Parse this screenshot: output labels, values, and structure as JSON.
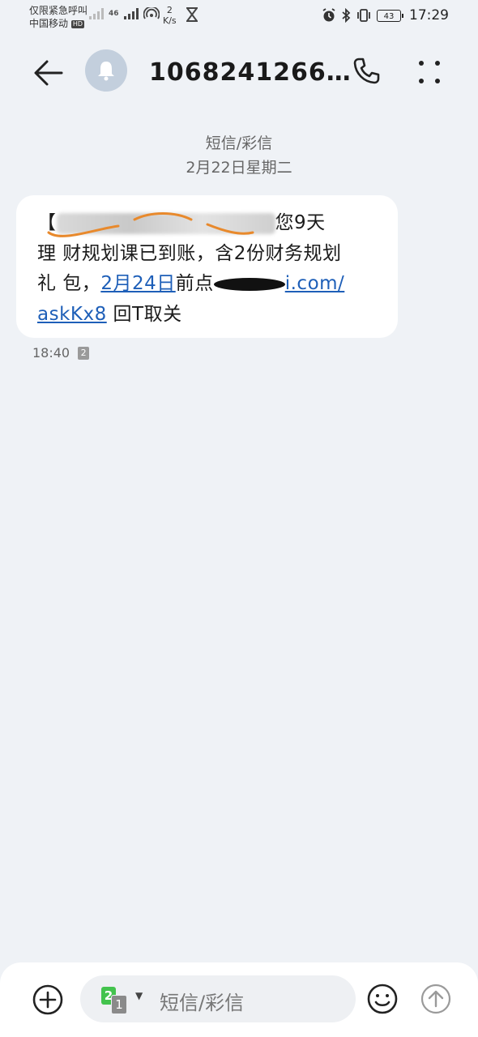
{
  "status_bar": {
    "emergency_text": "仅限紧急呼叫",
    "carrier": "中国移动",
    "hd_badge": "HD",
    "network": "46",
    "speed_value": "2",
    "speed_unit": "K/s",
    "battery": "43",
    "time": "17:29"
  },
  "header": {
    "title": "1068241266…"
  },
  "conversation": {
    "message_type": "短信/彩信",
    "date": "2月22日星期二",
    "message": {
      "bracket_open": "【",
      "text_part1": "您9天",
      "text_line2": "理 财规划课已到账，含2份财务规划",
      "text_line3_prefix": "礼 包，",
      "date_link": "2月24日",
      "text_before_link": "前点",
      "link_visible": "i.com/",
      "link_line2": "askKx8",
      "text_suffix": " 回T取关"
    },
    "time": "18:40",
    "sim_badge": "2"
  },
  "composer": {
    "sim_primary": "2",
    "sim_secondary": "1",
    "placeholder": "短信/彩信"
  },
  "colors": {
    "background": "#eff2f6",
    "bubble": "#ffffff",
    "link": "#1e5fb8",
    "avatar": "#c3cfdd",
    "sim_green": "#43c34d"
  },
  "icons": {
    "back": "arrow-left-icon",
    "avatar": "bell-icon",
    "call": "phone-icon",
    "menu": "more-dots-icon",
    "add": "plus-circle-icon",
    "emoji": "emoji-icon",
    "send": "send-arrow-icon"
  }
}
